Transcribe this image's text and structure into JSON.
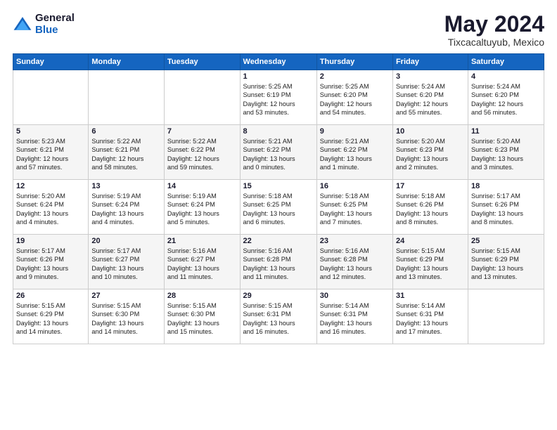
{
  "header": {
    "logo": {
      "general_label": "General",
      "blue_label": "Blue"
    },
    "title": "May 2024",
    "location": "Tixcacaltuyub, Mexico"
  },
  "calendar": {
    "days_of_week": [
      "Sunday",
      "Monday",
      "Tuesday",
      "Wednesday",
      "Thursday",
      "Friday",
      "Saturday"
    ],
    "weeks": [
      [
        {
          "day": "",
          "info": ""
        },
        {
          "day": "",
          "info": ""
        },
        {
          "day": "",
          "info": ""
        },
        {
          "day": "1",
          "info": "Sunrise: 5:25 AM\nSunset: 6:19 PM\nDaylight: 12 hours\nand 53 minutes."
        },
        {
          "day": "2",
          "info": "Sunrise: 5:25 AM\nSunset: 6:20 PM\nDaylight: 12 hours\nand 54 minutes."
        },
        {
          "day": "3",
          "info": "Sunrise: 5:24 AM\nSunset: 6:20 PM\nDaylight: 12 hours\nand 55 minutes."
        },
        {
          "day": "4",
          "info": "Sunrise: 5:24 AM\nSunset: 6:20 PM\nDaylight: 12 hours\nand 56 minutes."
        }
      ],
      [
        {
          "day": "5",
          "info": "Sunrise: 5:23 AM\nSunset: 6:21 PM\nDaylight: 12 hours\nand 57 minutes."
        },
        {
          "day": "6",
          "info": "Sunrise: 5:22 AM\nSunset: 6:21 PM\nDaylight: 12 hours\nand 58 minutes."
        },
        {
          "day": "7",
          "info": "Sunrise: 5:22 AM\nSunset: 6:22 PM\nDaylight: 12 hours\nand 59 minutes."
        },
        {
          "day": "8",
          "info": "Sunrise: 5:21 AM\nSunset: 6:22 PM\nDaylight: 13 hours\nand 0 minutes."
        },
        {
          "day": "9",
          "info": "Sunrise: 5:21 AM\nSunset: 6:22 PM\nDaylight: 13 hours\nand 1 minute."
        },
        {
          "day": "10",
          "info": "Sunrise: 5:20 AM\nSunset: 6:23 PM\nDaylight: 13 hours\nand 2 minutes."
        },
        {
          "day": "11",
          "info": "Sunrise: 5:20 AM\nSunset: 6:23 PM\nDaylight: 13 hours\nand 3 minutes."
        }
      ],
      [
        {
          "day": "12",
          "info": "Sunrise: 5:20 AM\nSunset: 6:24 PM\nDaylight: 13 hours\nand 4 minutes."
        },
        {
          "day": "13",
          "info": "Sunrise: 5:19 AM\nSunset: 6:24 PM\nDaylight: 13 hours\nand 4 minutes."
        },
        {
          "day": "14",
          "info": "Sunrise: 5:19 AM\nSunset: 6:24 PM\nDaylight: 13 hours\nand 5 minutes."
        },
        {
          "day": "15",
          "info": "Sunrise: 5:18 AM\nSunset: 6:25 PM\nDaylight: 13 hours\nand 6 minutes."
        },
        {
          "day": "16",
          "info": "Sunrise: 5:18 AM\nSunset: 6:25 PM\nDaylight: 13 hours\nand 7 minutes."
        },
        {
          "day": "17",
          "info": "Sunrise: 5:18 AM\nSunset: 6:26 PM\nDaylight: 13 hours\nand 8 minutes."
        },
        {
          "day": "18",
          "info": "Sunrise: 5:17 AM\nSunset: 6:26 PM\nDaylight: 13 hours\nand 8 minutes."
        }
      ],
      [
        {
          "day": "19",
          "info": "Sunrise: 5:17 AM\nSunset: 6:26 PM\nDaylight: 13 hours\nand 9 minutes."
        },
        {
          "day": "20",
          "info": "Sunrise: 5:17 AM\nSunset: 6:27 PM\nDaylight: 13 hours\nand 10 minutes."
        },
        {
          "day": "21",
          "info": "Sunrise: 5:16 AM\nSunset: 6:27 PM\nDaylight: 13 hours\nand 11 minutes."
        },
        {
          "day": "22",
          "info": "Sunrise: 5:16 AM\nSunset: 6:28 PM\nDaylight: 13 hours\nand 11 minutes."
        },
        {
          "day": "23",
          "info": "Sunrise: 5:16 AM\nSunset: 6:28 PM\nDaylight: 13 hours\nand 12 minutes."
        },
        {
          "day": "24",
          "info": "Sunrise: 5:15 AM\nSunset: 6:29 PM\nDaylight: 13 hours\nand 13 minutes."
        },
        {
          "day": "25",
          "info": "Sunrise: 5:15 AM\nSunset: 6:29 PM\nDaylight: 13 hours\nand 13 minutes."
        }
      ],
      [
        {
          "day": "26",
          "info": "Sunrise: 5:15 AM\nSunset: 6:29 PM\nDaylight: 13 hours\nand 14 minutes."
        },
        {
          "day": "27",
          "info": "Sunrise: 5:15 AM\nSunset: 6:30 PM\nDaylight: 13 hours\nand 14 minutes."
        },
        {
          "day": "28",
          "info": "Sunrise: 5:15 AM\nSunset: 6:30 PM\nDaylight: 13 hours\nand 15 minutes."
        },
        {
          "day": "29",
          "info": "Sunrise: 5:15 AM\nSunset: 6:31 PM\nDaylight: 13 hours\nand 16 minutes."
        },
        {
          "day": "30",
          "info": "Sunrise: 5:14 AM\nSunset: 6:31 PM\nDaylight: 13 hours\nand 16 minutes."
        },
        {
          "day": "31",
          "info": "Sunrise: 5:14 AM\nSunset: 6:31 PM\nDaylight: 13 hours\nand 17 minutes."
        },
        {
          "day": "",
          "info": ""
        }
      ]
    ]
  }
}
